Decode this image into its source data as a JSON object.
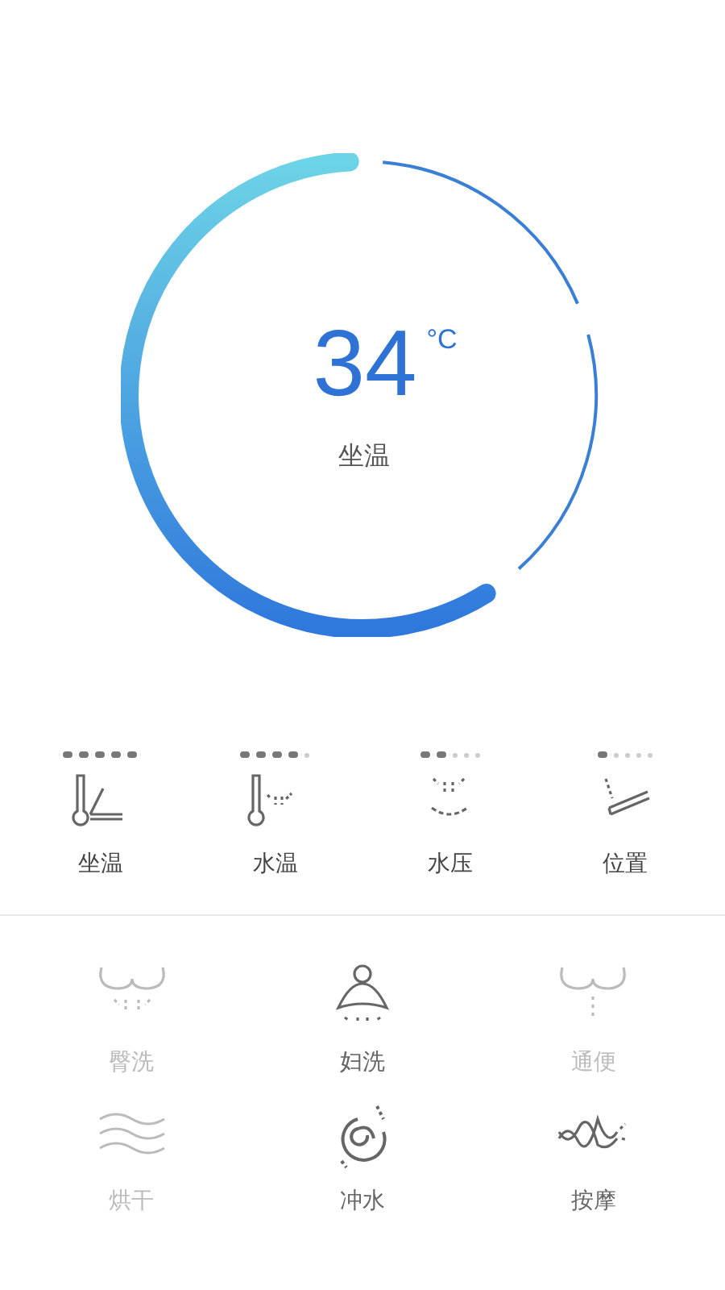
{
  "dial": {
    "value": "34",
    "unit": "°C",
    "label": "坐温"
  },
  "settings": [
    {
      "label": "坐温",
      "kind": "seat",
      "stars": 5
    },
    {
      "label": "水温",
      "kind": "water",
      "stars": 4
    },
    {
      "label": "水压",
      "kind": "pressure",
      "stars": 2
    },
    {
      "label": "位置",
      "kind": "position",
      "stars": 1
    }
  ],
  "modes": [
    {
      "label": "臀洗",
      "kind": "rear",
      "disabled": true
    },
    {
      "label": "妇洗",
      "kind": "feminine",
      "disabled": false
    },
    {
      "label": "通便",
      "kind": "enema",
      "disabled": true
    },
    {
      "label": "烘干",
      "kind": "dry",
      "disabled": true
    },
    {
      "label": "冲水",
      "kind": "flush",
      "disabled": false
    },
    {
      "label": "按摩",
      "kind": "massage",
      "disabled": false
    }
  ]
}
